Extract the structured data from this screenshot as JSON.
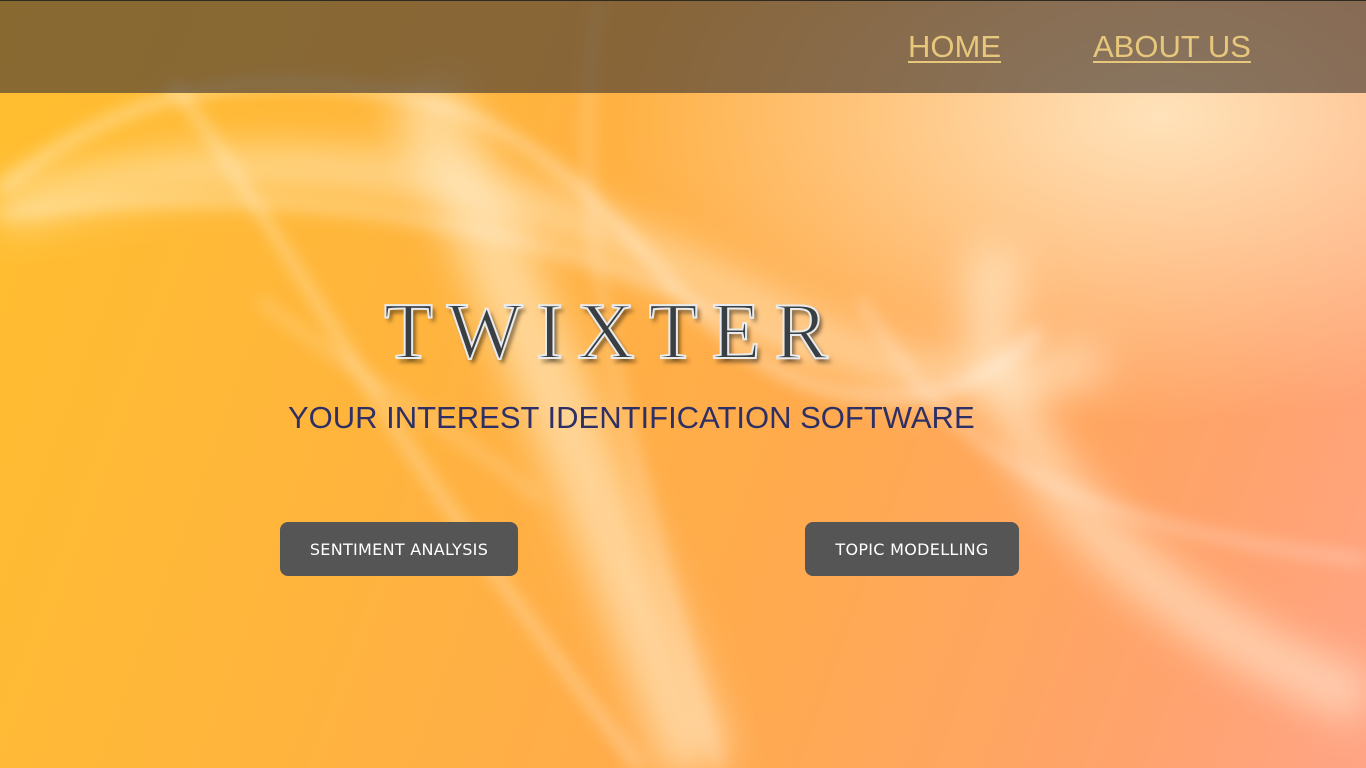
{
  "nav": {
    "home_label": "HOME",
    "about_label": "ABOUT US"
  },
  "hero": {
    "logo_text": "TWIXTER",
    "tagline": "YOUR INTEREST IDENTIFICATION SOFTWARE"
  },
  "actions": {
    "sentiment_label": "SENTIMENT ANALYSIS",
    "topic_label": "TOPIC MODELLING"
  },
  "colors": {
    "nav_bar": "#483c32",
    "nav_link": "#e7c77b",
    "tagline": "#2e3065",
    "button_bg": "#555555",
    "button_text": "#ffffff",
    "background_warm": "#ffb53c"
  }
}
